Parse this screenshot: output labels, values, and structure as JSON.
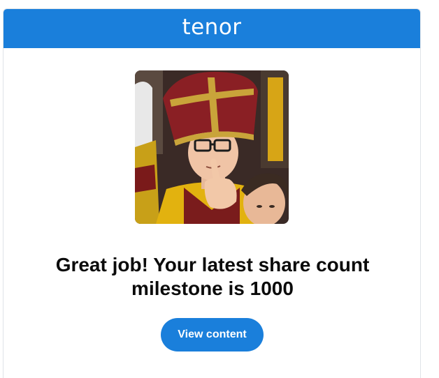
{
  "header": {
    "logo_text": "tenor"
  },
  "gif": {
    "alt": "celebration gif"
  },
  "message": {
    "headline_line1": "Great job! Your latest share count",
    "headline_line2": "milestone is 1000"
  },
  "cta": {
    "label": "View content"
  },
  "colors": {
    "brand_blue": "#1a7fdb",
    "text": "#0b0b0b"
  }
}
